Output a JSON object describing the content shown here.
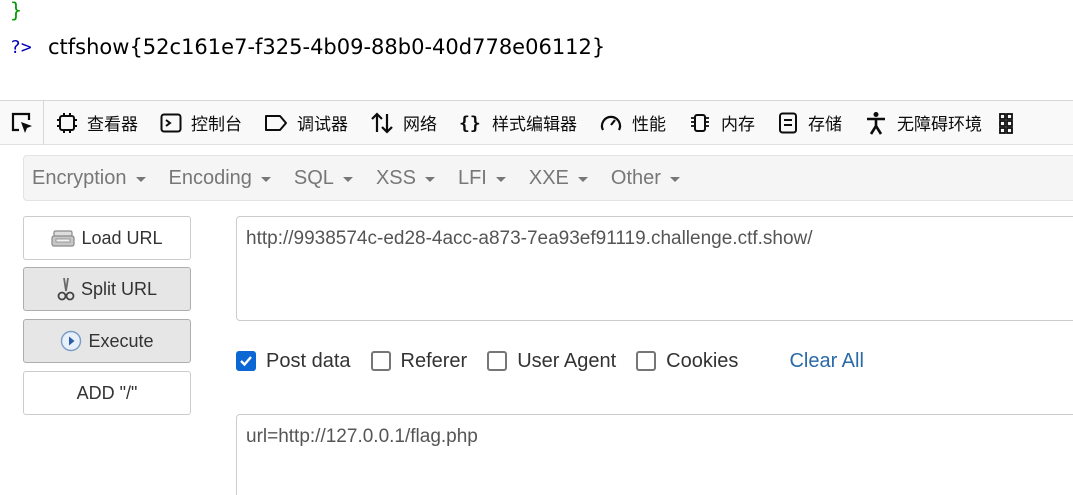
{
  "page_output": {
    "brace": "}",
    "php_close": "?>",
    "flag": "ctfshow{52c161e7-f325-4b09-88b0-40d778e06112}"
  },
  "devtools": {
    "tabs": [
      {
        "label": "查看器",
        "icon": "inspector-icon"
      },
      {
        "label": "控制台",
        "icon": "console-icon"
      },
      {
        "label": "调试器",
        "icon": "debugger-icon"
      },
      {
        "label": "网络",
        "icon": "network-icon"
      },
      {
        "label": "样式编辑器",
        "icon": "style-editor-icon"
      },
      {
        "label": "性能",
        "icon": "performance-icon"
      },
      {
        "label": "内存",
        "icon": "memory-icon"
      },
      {
        "label": "存储",
        "icon": "storage-icon"
      },
      {
        "label": "无障碍环境",
        "icon": "accessibility-icon"
      }
    ]
  },
  "hackbar": {
    "menu": [
      "Encryption",
      "Encoding",
      "SQL",
      "XSS",
      "LFI",
      "XXE",
      "Other"
    ],
    "buttons": {
      "load_url": "Load URL",
      "split_url": "Split URL",
      "execute": "Execute",
      "add_slash": "ADD \"/\""
    },
    "url_value": "http://9938574c-ed28-4acc-a873-7ea93ef91119.challenge.ctf.show/",
    "options": [
      {
        "label": "Post data",
        "checked": true
      },
      {
        "label": "Referer",
        "checked": false
      },
      {
        "label": "User Agent",
        "checked": false
      },
      {
        "label": "Cookies",
        "checked": false
      }
    ],
    "clear_all": "Clear All",
    "post_value": "url=http://127.0.0.1/flag.php"
  },
  "colors": {
    "checkbox_accent": "#0a67d3",
    "link": "#2a6aa6",
    "brace_green": "#079a07",
    "php_tag_blue": "#0000bb"
  }
}
